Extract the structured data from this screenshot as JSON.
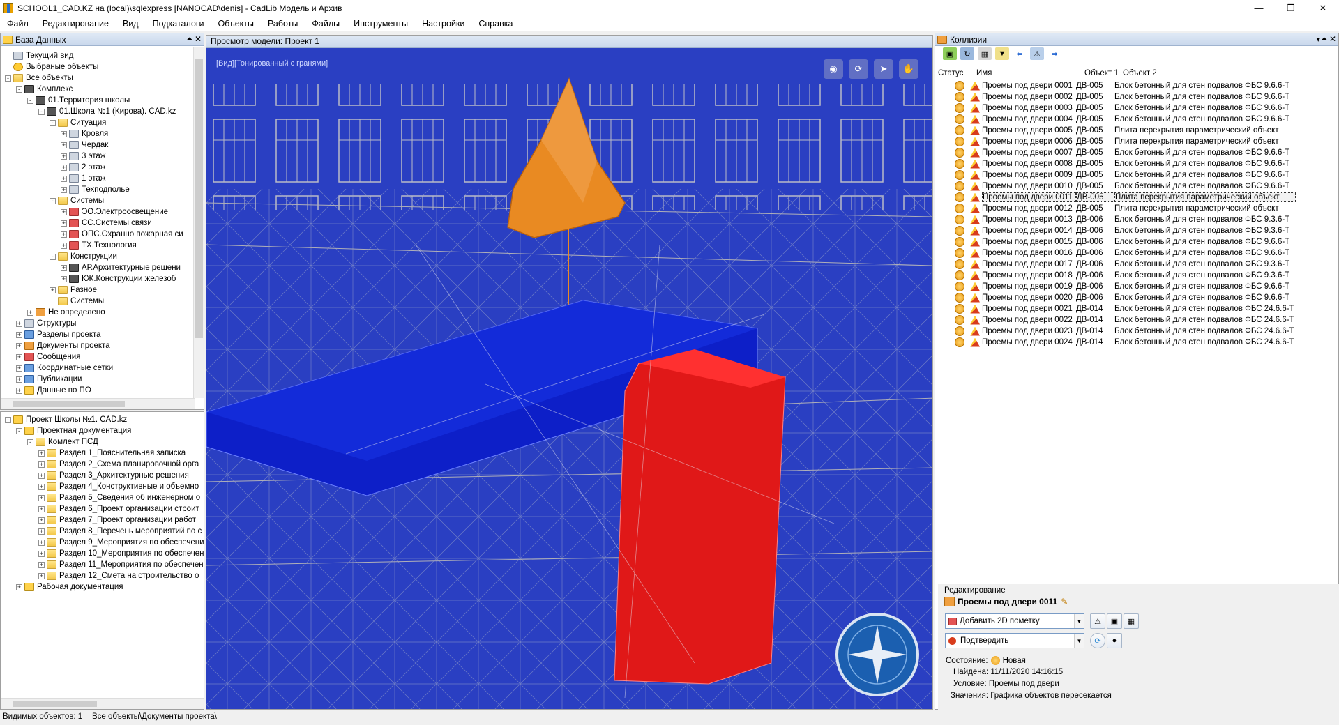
{
  "window": {
    "title": "SCHOOL1_CAD.KZ на (local)\\sqlexpress [NANOCAD\\denis] - CadLib Модель и Архив"
  },
  "menu": [
    "Файл",
    "Редактирование",
    "Вид",
    "Подкаталоги",
    "Объекты",
    "Работы",
    "Файлы",
    "Инструменты",
    "Настройки",
    "Справка"
  ],
  "db_panel": {
    "title": "База Данных",
    "items": [
      {
        "label": "Текущий вид",
        "level": 0,
        "exp": "",
        "icon": "gray"
      },
      {
        "label": "Выбраные объекты",
        "level": 0,
        "exp": "",
        "icon": "star"
      },
      {
        "label": "Все объекты",
        "level": 0,
        "exp": "-",
        "icon": "folder"
      },
      {
        "label": "Комплекс",
        "level": 1,
        "exp": "-",
        "icon": "dark"
      },
      {
        "label": "01.Территория школы",
        "level": 2,
        "exp": "-",
        "icon": "dark"
      },
      {
        "label": "01.Школа №1 (Кирова). CAD.kz",
        "level": 3,
        "exp": "-",
        "icon": "dark"
      },
      {
        "label": "Ситуация",
        "level": 4,
        "exp": "-",
        "icon": "folder"
      },
      {
        "label": "Кровля",
        "level": 5,
        "exp": "+",
        "icon": "gray"
      },
      {
        "label": "Чердак",
        "level": 5,
        "exp": "+",
        "icon": "gray"
      },
      {
        "label": "3 этаж",
        "level": 5,
        "exp": "+",
        "icon": "gray"
      },
      {
        "label": "2 этаж",
        "level": 5,
        "exp": "+",
        "icon": "gray"
      },
      {
        "label": "1 этаж",
        "level": 5,
        "exp": "+",
        "icon": "gray"
      },
      {
        "label": "Техподполье",
        "level": 5,
        "exp": "+",
        "icon": "gray"
      },
      {
        "label": "Системы",
        "level": 4,
        "exp": "-",
        "icon": "folder"
      },
      {
        "label": "ЭО.Электроосвещение",
        "level": 5,
        "exp": "+",
        "icon": "red"
      },
      {
        "label": "СС.Системы связи",
        "level": 5,
        "exp": "+",
        "icon": "red"
      },
      {
        "label": "ОПС.Охранно пожарная си",
        "level": 5,
        "exp": "+",
        "icon": "red"
      },
      {
        "label": "ТХ.Технология",
        "level": 5,
        "exp": "+",
        "icon": "red"
      },
      {
        "label": "Конструкции",
        "level": 4,
        "exp": "-",
        "icon": "folder"
      },
      {
        "label": "АР.Архитектурные решени",
        "level": 5,
        "exp": "+",
        "icon": "dark"
      },
      {
        "label": "КЖ.Конструкции железоб",
        "level": 5,
        "exp": "+",
        "icon": "dark"
      },
      {
        "label": "Разное",
        "level": 4,
        "exp": "+",
        "icon": "folder"
      },
      {
        "label": "Системы",
        "level": 4,
        "exp": "",
        "icon": "folder"
      },
      {
        "label": "Не определено",
        "level": 2,
        "exp": "+",
        "icon": "orange"
      },
      {
        "label": "Структуры",
        "level": 1,
        "exp": "+",
        "icon": "gray"
      },
      {
        "label": "Разделы проекта",
        "level": 1,
        "exp": "+",
        "icon": "blue"
      },
      {
        "label": "Документы проекта",
        "level": 1,
        "exp": "+",
        "icon": "orange"
      },
      {
        "label": "Сообщения",
        "level": 1,
        "exp": "+",
        "icon": "red"
      },
      {
        "label": "Координатные сетки",
        "level": 1,
        "exp": "+",
        "icon": "blue"
      },
      {
        "label": "Публикации",
        "level": 1,
        "exp": "+",
        "icon": "blue"
      },
      {
        "label": "Данные по ПО",
        "level": 1,
        "exp": "+",
        "icon": "yellow"
      }
    ]
  },
  "project_panel": {
    "items": [
      {
        "label": "Проект Школы №1. CAD.kz",
        "level": 0,
        "exp": "-",
        "icon": "yellow"
      },
      {
        "label": "Проектная документация",
        "level": 1,
        "exp": "-",
        "icon": "yellow"
      },
      {
        "label": "Комлект ПСД",
        "level": 2,
        "exp": "-",
        "icon": "folder"
      },
      {
        "label": "Раздел 1_Пояснительная записка",
        "level": 3,
        "exp": "+",
        "icon": "folder"
      },
      {
        "label": "Раздел 2_Схема планировочной орга",
        "level": 3,
        "exp": "+",
        "icon": "folder"
      },
      {
        "label": "Раздел 3_Архитектурные решения",
        "level": 3,
        "exp": "+",
        "icon": "folder"
      },
      {
        "label": "Раздел 4_Конструктивные и объемно",
        "level": 3,
        "exp": "+",
        "icon": "folder"
      },
      {
        "label": "Раздел 5_Сведения об инженерном о",
        "level": 3,
        "exp": "+",
        "icon": "folder"
      },
      {
        "label": "Раздел 6_Проект организации строит",
        "level": 3,
        "exp": "+",
        "icon": "folder"
      },
      {
        "label": "Раздел 7_Проект организации работ",
        "level": 3,
        "exp": "+",
        "icon": "folder"
      },
      {
        "label": "Раздел 8_Перечень мероприятий по с",
        "level": 3,
        "exp": "+",
        "icon": "folder"
      },
      {
        "label": "Раздел 9_Мероприятия по обеспечени",
        "level": 3,
        "exp": "+",
        "icon": "folder"
      },
      {
        "label": "Раздел 10_Мероприятия по обеспечен",
        "level": 3,
        "exp": "+",
        "icon": "folder"
      },
      {
        "label": "Раздел 11_Мероприятия по обеспечен",
        "level": 3,
        "exp": "+",
        "icon": "folder"
      },
      {
        "label": "Раздел 12_Смета на строительство о",
        "level": 3,
        "exp": "+",
        "icon": "folder"
      },
      {
        "label": "Рабочая документация",
        "level": 1,
        "exp": "+",
        "icon": "yellow"
      }
    ]
  },
  "viewport": {
    "title": "Просмотр модели: Проект 1",
    "mode_label": "[Вид][Тонированный с гранями]"
  },
  "collisions": {
    "title": "Коллизии",
    "headers": {
      "status": "Статус",
      "name": "Имя",
      "obj1": "Объект 1",
      "obj2": "Объект 2"
    },
    "selected_index": 10,
    "rows": [
      {
        "name": "Проемы под двери 0001",
        "o1": "ДВ-005",
        "o2": "Блок бетонный для стен подвалов ФБС 9.6.6-Т"
      },
      {
        "name": "Проемы под двери 0002",
        "o1": "ДВ-005",
        "o2": "Блок бетонный для стен подвалов ФБС 9.6.6-Т"
      },
      {
        "name": "Проемы под двери 0003",
        "o1": "ДВ-005",
        "o2": "Блок бетонный для стен подвалов ФБС 9.6.6-Т"
      },
      {
        "name": "Проемы под двери 0004",
        "o1": "ДВ-005",
        "o2": "Блок бетонный для стен подвалов ФБС 9.6.6-Т"
      },
      {
        "name": "Проемы под двери 0005",
        "o1": "ДВ-005",
        "o2": "Плита перекрытия параметрический объект"
      },
      {
        "name": "Проемы под двери 0006",
        "o1": "ДВ-005",
        "o2": "Плита перекрытия параметрический объект"
      },
      {
        "name": "Проемы под двери 0007",
        "o1": "ДВ-005",
        "o2": "Блок бетонный для стен подвалов ФБС 9.6.6-Т"
      },
      {
        "name": "Проемы под двери 0008",
        "o1": "ДВ-005",
        "o2": "Блок бетонный для стен подвалов ФБС 9.6.6-Т"
      },
      {
        "name": "Проемы под двери 0009",
        "o1": "ДВ-005",
        "o2": "Блок бетонный для стен подвалов ФБС 9.6.6-Т"
      },
      {
        "name": "Проемы под двери 0010",
        "o1": "ДВ-005",
        "o2": "Блок бетонный для стен подвалов ФБС 9.6.6-Т"
      },
      {
        "name": "Проемы под двери 0011",
        "o1": "ДВ-005",
        "o2": "Плита перекрытия параметрический объект"
      },
      {
        "name": "Проемы под двери 0012",
        "o1": "ДВ-005",
        "o2": "Плита перекрытия параметрический объект"
      },
      {
        "name": "Проемы под двери 0013",
        "o1": "ДВ-006",
        "o2": "Блок бетонный для стен подвалов ФБС 9.3.6-Т"
      },
      {
        "name": "Проемы под двери 0014",
        "o1": "ДВ-006",
        "o2": "Блок бетонный для стен подвалов ФБС 9.3.6-Т"
      },
      {
        "name": "Проемы под двери 0015",
        "o1": "ДВ-006",
        "o2": "Блок бетонный для стен подвалов ФБС 9.6.6-Т"
      },
      {
        "name": "Проемы под двери 0016",
        "o1": "ДВ-006",
        "o2": "Блок бетонный для стен подвалов ФБС 9.6.6-Т"
      },
      {
        "name": "Проемы под двери 0017",
        "o1": "ДВ-006",
        "o2": "Блок бетонный для стен подвалов ФБС 9.3.6-Т"
      },
      {
        "name": "Проемы под двери 0018",
        "o1": "ДВ-006",
        "o2": "Блок бетонный для стен подвалов ФБС 9.3.6-Т"
      },
      {
        "name": "Проемы под двери 0019",
        "o1": "ДВ-006",
        "o2": "Блок бетонный для стен подвалов ФБС 9.6.6-Т"
      },
      {
        "name": "Проемы под двери 0020",
        "o1": "ДВ-006",
        "o2": "Блок бетонный для стен подвалов ФБС 9.6.6-Т"
      },
      {
        "name": "Проемы под двери 0021",
        "o1": "ДВ-014",
        "o2": "Блок бетонный для стен подвалов ФБС 24.6.6-Т"
      },
      {
        "name": "Проемы под двери 0022",
        "o1": "ДВ-014",
        "o2": "Блок бетонный для стен подвалов ФБС 24.6.6-Т"
      },
      {
        "name": "Проемы под двери 0023",
        "o1": "ДВ-014",
        "o2": "Блок бетонный для стен подвалов ФБС 24.6.6-Т"
      },
      {
        "name": "Проемы под двери 0024",
        "o1": "ДВ-014",
        "o2": "Блок бетонный для стен подвалов ФБС 24.6.6-Т"
      }
    ]
  },
  "edit": {
    "section_label": "Редактирование",
    "collision_name": "Проемы под двери 0011",
    "add_mark_label": "Добавить 2D пометку",
    "confirm_label": "Подтвердить",
    "state_label": "Состояние:",
    "state_value": "Новая",
    "found": "Найдена: 11/11/2020 14:16:15",
    "condition": "Условие: Проемы под двери",
    "values": "Значения: Графика объектов пересекается"
  },
  "statusbar": {
    "visible": "Видимых объектов: 1",
    "path": "Все объекты\\Документы проекта\\"
  },
  "colors": {
    "viewport_bg": "#2a3fc2",
    "slab": "#0d1fc8",
    "wall": "#e01818",
    "cone": "#e98a22"
  }
}
